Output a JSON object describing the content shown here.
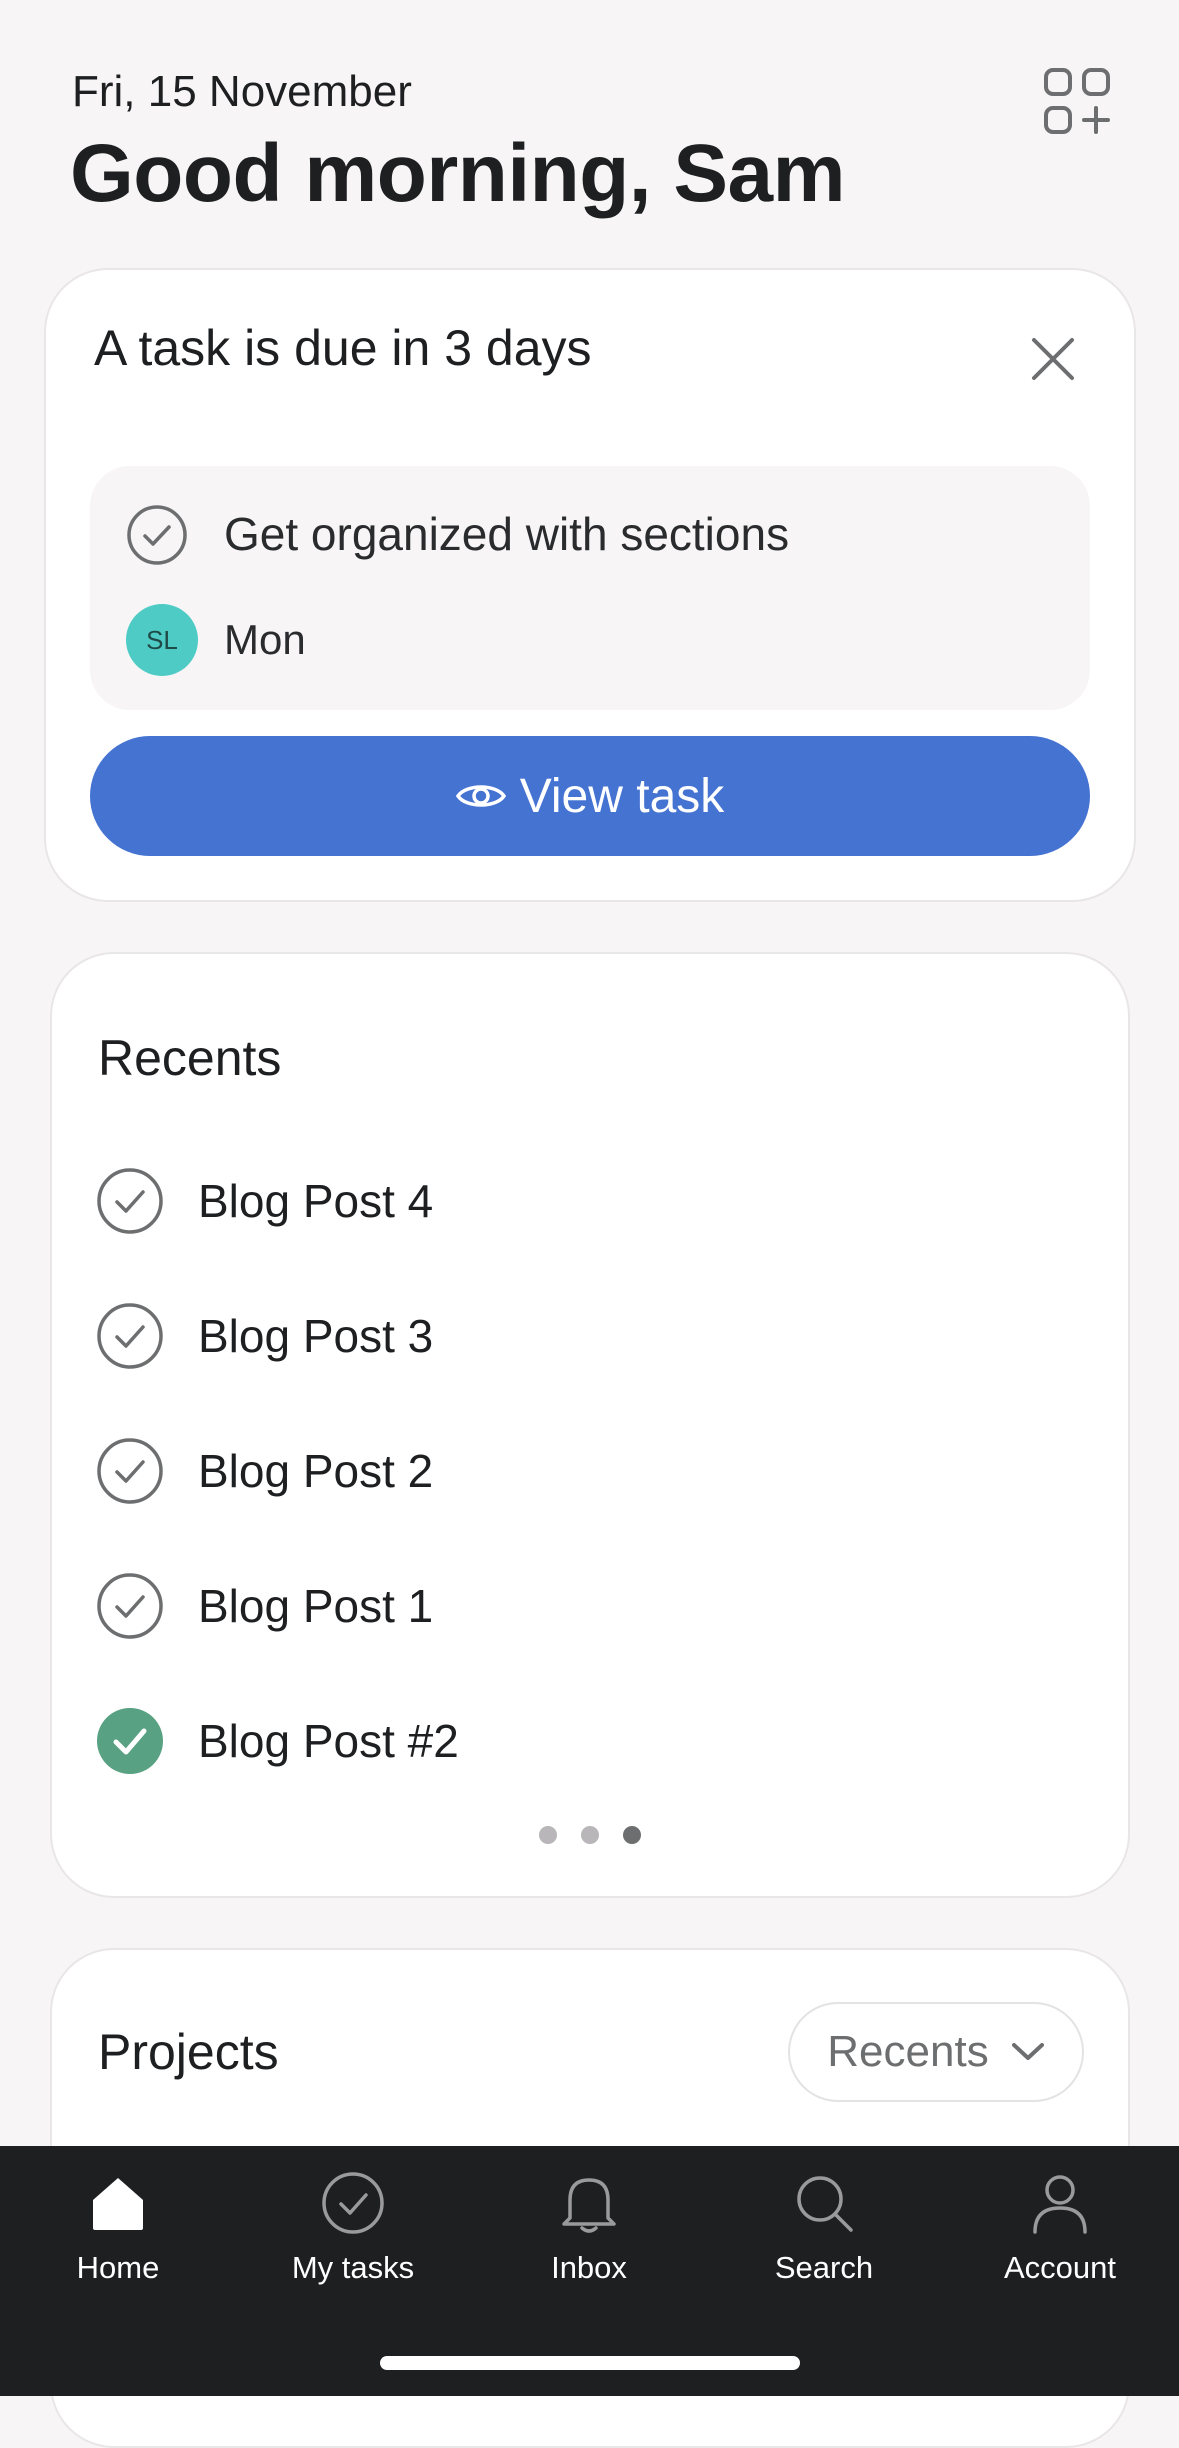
{
  "header": {
    "date": "Fri, 15 November",
    "greeting": "Good morning, Sam",
    "customize_icon": "widgets-add-icon"
  },
  "due_card": {
    "title": "A task is due in 3 days",
    "task_name": "Get organized with sections",
    "assignee_initials": "SL",
    "due_day": "Mon",
    "button_label": "View task",
    "accent_color": "#4573d2",
    "avatar_color": "#4ecbc4"
  },
  "recents": {
    "title": "Recents",
    "items": [
      {
        "label": "Blog Post 4",
        "completed": false
      },
      {
        "label": "Blog Post 3",
        "completed": false
      },
      {
        "label": "Blog Post 2",
        "completed": false
      },
      {
        "label": "Blog Post 1",
        "completed": false
      },
      {
        "label": "Blog Post #2",
        "completed": true
      }
    ],
    "page_count": 3,
    "active_page": 3,
    "completed_color": "#58a182"
  },
  "projects": {
    "title": "Projects",
    "sort_label": "Recents"
  },
  "nav": {
    "items": [
      {
        "label": "Home",
        "icon": "home-icon",
        "active": true
      },
      {
        "label": "My tasks",
        "icon": "check-circle-icon",
        "active": false
      },
      {
        "label": "Inbox",
        "icon": "bell-icon",
        "active": false
      },
      {
        "label": "Search",
        "icon": "search-icon",
        "active": false
      },
      {
        "label": "Account",
        "icon": "person-icon",
        "active": false
      }
    ]
  }
}
